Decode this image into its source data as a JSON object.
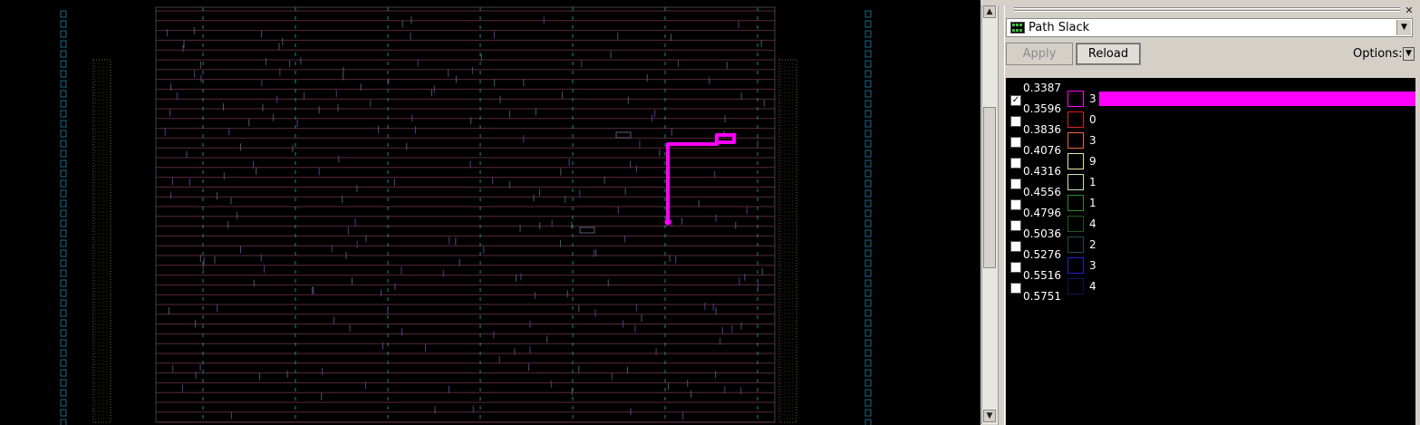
{
  "panel": {
    "mode": "Path Slack",
    "apply_label": "Apply",
    "reload_label": "Reload",
    "options_label": "Options:"
  },
  "legend": {
    "bounds": [
      "0.3387",
      "0.3596",
      "0.3836",
      "0.4076",
      "0.4316",
      "0.4556",
      "0.4796",
      "0.5036",
      "0.5276",
      "0.5516",
      "0.5751"
    ],
    "bins": [
      {
        "count": "3",
        "checked": true,
        "color": "#ff00ff",
        "fraction": 1.0
      },
      {
        "count": "0",
        "checked": false,
        "color": "#dd2222",
        "fraction": 0
      },
      {
        "count": "3",
        "checked": false,
        "color": "#ee6644",
        "fraction": 0
      },
      {
        "count": "9",
        "checked": false,
        "color": "#e8e8a0",
        "fraction": 0
      },
      {
        "count": "1",
        "checked": false,
        "color": "#c8e8b8",
        "fraction": 0
      },
      {
        "count": "1",
        "checked": false,
        "color": "#2e8a2e",
        "fraction": 0
      },
      {
        "count": "4",
        "checked": false,
        "color": "#1e5a1e",
        "fraction": 0
      },
      {
        "count": "2",
        "checked": false,
        "color": "#1e4a5a",
        "fraction": 0
      },
      {
        "count": "3",
        "checked": false,
        "color": "#2222cc",
        "fraction": 0
      },
      {
        "count": "4",
        "checked": false,
        "color": "#121250",
        "fraction": 0
      }
    ]
  },
  "colors": {
    "highlight_path": "#ff00ff",
    "cell_rows": "#5a2a3a",
    "power_stripes": "#1a8a7a",
    "io_pins": "#1a6a8a",
    "filler": "#6a6a2a",
    "cell_pins": "#5a3a8a"
  },
  "icons": {
    "mode_icon": "heatmap-icon",
    "dropdown": "chevron-down-icon",
    "scroll_up": "arrow-up-icon",
    "scroll_down": "arrow-down-icon"
  }
}
